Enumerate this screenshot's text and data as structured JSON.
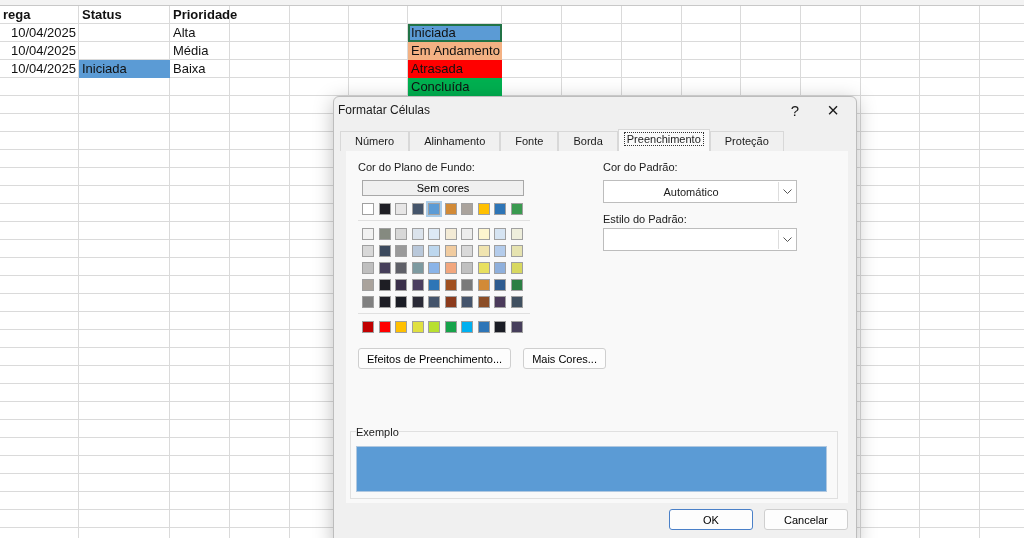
{
  "sheet": {
    "headers": [
      {
        "text": "rega"
      },
      {
        "text": "Status"
      },
      {
        "text": "Prioridade"
      }
    ],
    "rows": [
      {
        "date": "10/04/2025",
        "priority": "Alta"
      },
      {
        "date": "10/04/2025",
        "priority": "Média"
      },
      {
        "date": "10/04/2025",
        "status": {
          "text": "Iniciada",
          "color": "#5b9bd5"
        },
        "priority": "Baixa"
      }
    ],
    "status_list": [
      {
        "text": "Iniciada",
        "color": "#5b9bd5",
        "selected": true
      },
      {
        "text": "Em Andamento",
        "color": "#f4b183",
        "selected": false
      },
      {
        "text": "Atrasada",
        "color": "#ff0000",
        "selected": false
      },
      {
        "text": "Concluída",
        "color": "#00b050",
        "selected": false
      }
    ]
  },
  "dialog": {
    "title": "Formatar Células",
    "help": "?",
    "close": "×",
    "tabs": [
      {
        "label": "Número",
        "selected": false
      },
      {
        "label": "Alinhamento",
        "selected": false
      },
      {
        "label": "Fonte",
        "selected": false
      },
      {
        "label": "Borda",
        "selected": false
      },
      {
        "label": "Preenchimento",
        "selected": true
      },
      {
        "label": "Proteção",
        "selected": false
      }
    ],
    "background_label": "Cor do Plano de Fundo:",
    "no_color_button": "Sem cores",
    "theme_row": [
      {
        "color": "#ffffff",
        "selected": false
      },
      {
        "color": "#1e1e24",
        "selected": false
      },
      {
        "color": "#e7e6e6",
        "selected": false
      },
      {
        "color": "#44546a",
        "selected": false
      },
      {
        "color": "#5b9bd5",
        "selected": true
      },
      {
        "color": "#d28a36",
        "selected": false
      },
      {
        "color": "#aaa39c",
        "selected": false
      },
      {
        "color": "#ffc000",
        "selected": false
      },
      {
        "color": "#2e75b6",
        "selected": false
      },
      {
        "color": "#3a9a50",
        "selected": false
      }
    ],
    "shade_rows": [
      [
        {
          "color": "#f2f2f2",
          "selected": false
        },
        {
          "color": "#858a80",
          "selected": false
        },
        {
          "color": "#d8d8d8",
          "selected": false
        },
        {
          "color": "#dbe3ec",
          "selected": false
        },
        {
          "color": "#dde9f5",
          "selected": false
        },
        {
          "color": "#f3ebd6",
          "selected": false
        },
        {
          "color": "#ededed",
          "selected": false
        },
        {
          "color": "#fdf5cf",
          "selected": false
        },
        {
          "color": "#d6e4f2",
          "selected": false
        },
        {
          "color": "#eeeedc",
          "selected": false
        }
      ],
      [
        {
          "color": "#d8d8d8",
          "selected": false
        },
        {
          "color": "#3c4a5e",
          "selected": false
        },
        {
          "color": "#9a9a9a",
          "selected": false
        },
        {
          "color": "#b9c8da",
          "selected": false
        },
        {
          "color": "#bdd7ee",
          "selected": false
        },
        {
          "color": "#f1cca0",
          "selected": false
        },
        {
          "color": "#d9d9d9",
          "selected": false
        },
        {
          "color": "#f0e4b0",
          "selected": false
        },
        {
          "color": "#b4cceb",
          "selected": false
        },
        {
          "color": "#e6e3b0",
          "selected": false
        }
      ],
      [
        {
          "color": "#bfbfbf",
          "selected": false
        },
        {
          "color": "#463e5a",
          "selected": false
        },
        {
          "color": "#5f6068",
          "selected": false
        },
        {
          "color": "#7d9aa0",
          "selected": false
        },
        {
          "color": "#8ab4e8",
          "selected": false
        },
        {
          "color": "#f2a77e",
          "selected": false
        },
        {
          "color": "#c0c0c0",
          "selected": false
        },
        {
          "color": "#e8e060",
          "selected": false
        },
        {
          "color": "#8fb0dc",
          "selected": false
        },
        {
          "color": "#d8d860",
          "selected": false
        }
      ],
      [
        {
          "color": "#aaa39c",
          "selected": false
        },
        {
          "color": "#1e1e24",
          "selected": false
        },
        {
          "color": "#3a2f4a",
          "selected": false
        },
        {
          "color": "#4b3e60",
          "selected": false
        },
        {
          "color": "#2e75b6",
          "selected": false
        },
        {
          "color": "#a05020",
          "selected": false
        },
        {
          "color": "#7a7a7a",
          "selected": false
        },
        {
          "color": "#d28a36",
          "selected": false
        },
        {
          "color": "#2e5c90",
          "selected": false
        },
        {
          "color": "#2c7f44",
          "selected": false
        }
      ],
      [
        {
          "color": "#808080",
          "selected": false
        },
        {
          "color": "#1e1e25",
          "selected": false
        },
        {
          "color": "#1a1c24",
          "selected": false
        },
        {
          "color": "#2a2a36",
          "selected": false
        },
        {
          "color": "#44546b",
          "selected": false
        },
        {
          "color": "#8b3a1c",
          "selected": false
        },
        {
          "color": "#44546c",
          "selected": false
        },
        {
          "color": "#8b4d26",
          "selected": false
        },
        {
          "color": "#4a3a5a",
          "selected": false
        },
        {
          "color": "#405060",
          "selected": false
        }
      ]
    ],
    "standard_row": [
      {
        "color": "#c00000",
        "selected": false
      },
      {
        "color": "#ff0000",
        "selected": false
      },
      {
        "color": "#ffc001",
        "selected": false
      },
      {
        "color": "#e0e040",
        "selected": false
      },
      {
        "color": "#b8e030",
        "selected": false
      },
      {
        "color": "#16a34a",
        "selected": false
      },
      {
        "color": "#00b0f0",
        "selected": false
      },
      {
        "color": "#2e75b7",
        "selected": false
      },
      {
        "color": "#1a1c25",
        "selected": false
      },
      {
        "color": "#463e5b",
        "selected": false
      }
    ],
    "effects_button": "Efeitos de Preenchimento...",
    "more_colors_button": "Mais Cores...",
    "pattern_color_label": "Cor do Padrão:",
    "pattern_color_value": "Automático",
    "pattern_style_label": "Estilo do Padrão:",
    "sample_label": "Exemplo",
    "buttons": [
      {
        "label": "OK",
        "kind": "default"
      },
      {
        "label": "Cancelar",
        "kind": "normal"
      }
    ]
  }
}
